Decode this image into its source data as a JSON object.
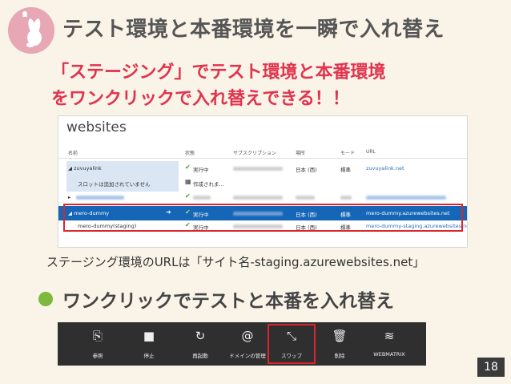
{
  "slide": {
    "title": "テスト環境と本番環境を一瞬で入れ替え",
    "subtitle_line1": "「ステージング」でテスト環境と本番環境",
    "subtitle_line2": "をワンクリックで入れ替えできる！！",
    "caption": "ステージング環境のURLは「サイト名-staging.azurewebsites.net」",
    "bullet": "ワンクリックでテストと本番を入れ替え",
    "page_number": "18"
  },
  "websites": {
    "title": "websites",
    "columns": [
      "名前",
      "状態",
      "サブスクリプション",
      "場所",
      "モード",
      "URL"
    ],
    "rows": [
      {
        "name": "◢ zuvuyalink",
        "status": "実行中",
        "location": "日本 (西)",
        "mode": "標準",
        "url": "zuvuyalink.net"
      },
      {
        "name": "スロットは追加されていません",
        "status": "作成されま..."
      },
      {
        "name": "▸"
      },
      {
        "name": "◢ mero-dummy",
        "arrow": "➜",
        "status": "実行中",
        "location": "日本 (西)",
        "mode": "標準",
        "url": "mero-dummy.azurewebsites.net"
      },
      {
        "name": "mero-dummy(staging)",
        "status": "実行中",
        "location": "日本 (西)",
        "mode": "標準",
        "url": "mero-dummy-staging.azurewebsites.net"
      }
    ]
  },
  "toolbar": {
    "buttons": [
      {
        "label": "参照",
        "icon": "browse-icon"
      },
      {
        "label": "停止",
        "icon": "stop-icon"
      },
      {
        "label": "再起動",
        "icon": "restart-icon"
      },
      {
        "label": "ドメインの管理",
        "icon": "domain-icon"
      },
      {
        "label": "スワップ",
        "icon": "swap-icon"
      },
      {
        "label": "削除",
        "icon": "trash-icon"
      },
      {
        "label": "WEBMATRIX",
        "icon": "webmatrix-icon"
      }
    ]
  },
  "colors": {
    "accent_red": "#e0334e",
    "highlight_box": "#d9252e",
    "selected_row": "#1566b7",
    "bullet_green": "#7db93c"
  }
}
